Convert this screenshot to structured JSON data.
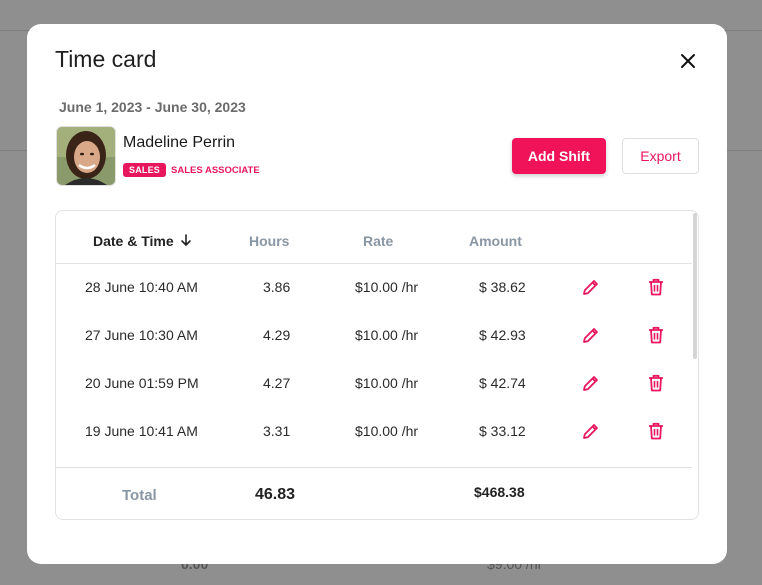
{
  "modal": {
    "title": "Time card",
    "date_range": "June 1, 2023 - June 30, 2023"
  },
  "employee": {
    "name": "Madeline Perrin",
    "department": "SALES",
    "role": "SALES ASSOCIATE"
  },
  "actions": {
    "add_shift": "Add Shift",
    "export": "Export"
  },
  "table": {
    "columns": {
      "date_time": "Date & Time",
      "hours": "Hours",
      "rate": "Rate",
      "amount": "Amount"
    },
    "sort_icon": "arrow-down-icon",
    "rows": [
      {
        "date_time": "28 June 10:40 AM",
        "hours": "3.86",
        "rate": "$10.00 /hr",
        "amount": "$ 38.62"
      },
      {
        "date_time": "27 June 10:30 AM",
        "hours": "4.29",
        "rate": "$10.00 /hr",
        "amount": "$ 42.93"
      },
      {
        "date_time": "20 June 01:59 PM",
        "hours": "4.27",
        "rate": "$10.00 /hr",
        "amount": "$ 42.74"
      },
      {
        "date_time": "19 June 10:41 AM",
        "hours": "3.31",
        "rate": "$10.00 /hr",
        "amount": "$ 33.12"
      }
    ],
    "row_icons": {
      "edit": "pencil-icon",
      "delete": "trash-icon"
    },
    "footer": {
      "label": "Total",
      "hours": "46.83",
      "amount": "$468.38"
    }
  },
  "background": {
    "left_value": "0.00",
    "right_value": "$9.00 /hr"
  },
  "colors": {
    "accent": "#f0135a",
    "header_text": "#8996a4",
    "backdrop": "#8f8f8f"
  }
}
